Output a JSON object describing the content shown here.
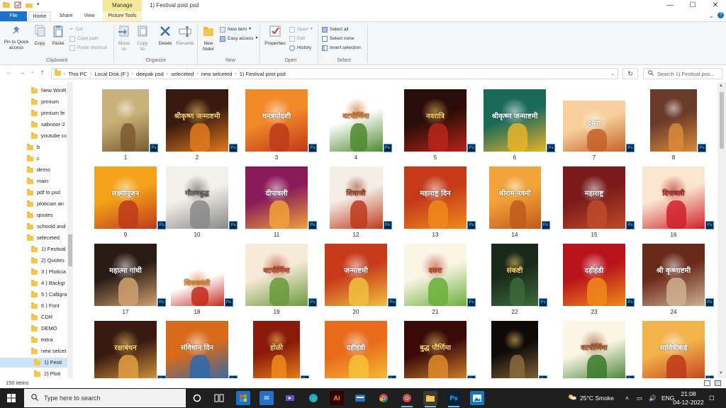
{
  "window": {
    "manage_tab": "Manage",
    "title": "1)  Festival post psd",
    "minimize": "—",
    "maximize": "☐",
    "close": "✕"
  },
  "ribbon_tabs": {
    "file": "File",
    "home": "Home",
    "share": "Share",
    "view": "View",
    "picture_tools": "Picture Tools"
  },
  "ribbon": {
    "clipboard": {
      "pin": "Pin to Quick access",
      "copy": "Copy",
      "paste": "Paste",
      "cut": "Cut",
      "copy_path": "Copy path",
      "paste_shortcut": "Paste shortcut",
      "label": "Clipboard"
    },
    "organize": {
      "move_to": "Move to",
      "copy_to": "Copy to",
      "delete": "Delete",
      "rename": "Rename",
      "label": "Organize"
    },
    "new": {
      "new_folder": "New folder",
      "new_item": "New item",
      "easy_access": "Easy access",
      "label": "New"
    },
    "open": {
      "properties": "Properties",
      "open": "Open",
      "edit": "Edit",
      "history": "History",
      "label": "Open"
    },
    "select": {
      "select_all": "Select all",
      "select_none": "Select none",
      "invert": "Invert selection",
      "label": "Select"
    }
  },
  "address": {
    "crumbs": [
      "This PC",
      "Local Disk (F:)",
      "deepak psd",
      "seleceted",
      "new selceted",
      "1)  Festival post psd"
    ],
    "search_placeholder": "Search 1)  Festival pos..."
  },
  "sidebar": {
    "items": [
      {
        "label": "New WinR"
      },
      {
        "label": "prmium"
      },
      {
        "label": "prmium fe"
      },
      {
        "label": "sabnoor-2"
      },
      {
        "label": "youtube cc"
      },
      {
        "label": "b"
      },
      {
        "label": "c"
      },
      {
        "label": "demo"
      },
      {
        "label": "main"
      },
      {
        "label": "pdf to psd"
      },
      {
        "label": "plotician an"
      },
      {
        "label": "qoutes"
      },
      {
        "label": "schoold and"
      },
      {
        "label": "seleceted"
      },
      {
        "label": "1)  Festival"
      },
      {
        "label": "2)  Quotes"
      },
      {
        "label": "3 ) Ploticia"
      },
      {
        "label": "4 ) Backgr"
      },
      {
        "label": "5 ) Calligra"
      },
      {
        "label": "6 ) Font"
      },
      {
        "label": "CDR"
      },
      {
        "label": "DEMO"
      },
      {
        "label": "extra"
      },
      {
        "label": "new selcet"
      },
      {
        "label": "1)  Festi"
      },
      {
        "label": "2) Ploti"
      }
    ]
  },
  "files": [
    {
      "num": "1",
      "text": ""
    },
    {
      "num": "2",
      "text": "श्रीकृष्ण जन्माष्टमी"
    },
    {
      "num": "3",
      "text": "धनत्रयोदशी"
    },
    {
      "num": "4",
      "text": "वटपौर्णिमा"
    },
    {
      "num": "5",
      "text": "नवरात्रि"
    },
    {
      "num": "6",
      "text": "श्रीकृष्ण जन्माष्टमी"
    },
    {
      "num": "7",
      "text": "दसरा"
    },
    {
      "num": "8",
      "text": ""
    },
    {
      "num": "9",
      "text": "लक्ष्मीपूजन"
    },
    {
      "num": "10",
      "text": "गौतमबुद्ध"
    },
    {
      "num": "11",
      "text": "दीपावली"
    },
    {
      "num": "12",
      "text": "शिवाजी"
    },
    {
      "num": "13",
      "text": "महाराष्ट्र दिन"
    },
    {
      "num": "14",
      "text": "श्रीराम नवमी"
    },
    {
      "num": "15",
      "text": "महाराष्ट्र"
    },
    {
      "num": "16",
      "text": "दिपावली"
    },
    {
      "num": "17",
      "text": "महात्मा गांधी"
    },
    {
      "num": "18",
      "text": "शिवजयंती"
    },
    {
      "num": "19",
      "text": "वटपौर्णिमा"
    },
    {
      "num": "20",
      "text": "जन्माष्टमी"
    },
    {
      "num": "21",
      "text": "दसरा"
    },
    {
      "num": "22",
      "text": "संकष्टी"
    },
    {
      "num": "23",
      "text": "दहीहंडी"
    },
    {
      "num": "24",
      "text": "श्री कृष्णाष्टमी"
    },
    {
      "num": "25",
      "text": "रक्षाबंधन"
    },
    {
      "num": "26",
      "text": "संविधान दिन"
    },
    {
      "num": "27",
      "text": "होळी"
    },
    {
      "num": "28",
      "text": "दहीहंडी"
    },
    {
      "num": "29",
      "text": "बुद्ध पौर्णिमा"
    },
    {
      "num": "30",
      "text": ""
    },
    {
      "num": "31",
      "text": "वटपौर्णिमा"
    },
    {
      "num": "32",
      "text": "सावित्रीबाई"
    }
  ],
  "ps_badge": "Ps",
  "status": {
    "items": "150 items"
  },
  "taskbar": {
    "search_placeholder": "Type here to search",
    "weather": "25°C  Smoke",
    "lang": "ENG",
    "time": "21:08",
    "date": "04-12-2022"
  },
  "colors": {
    "accent": "#1a73c9",
    "manage": "#f6e89a",
    "taskbar": "#1f1f1f",
    "folder": "#f4c64b"
  }
}
